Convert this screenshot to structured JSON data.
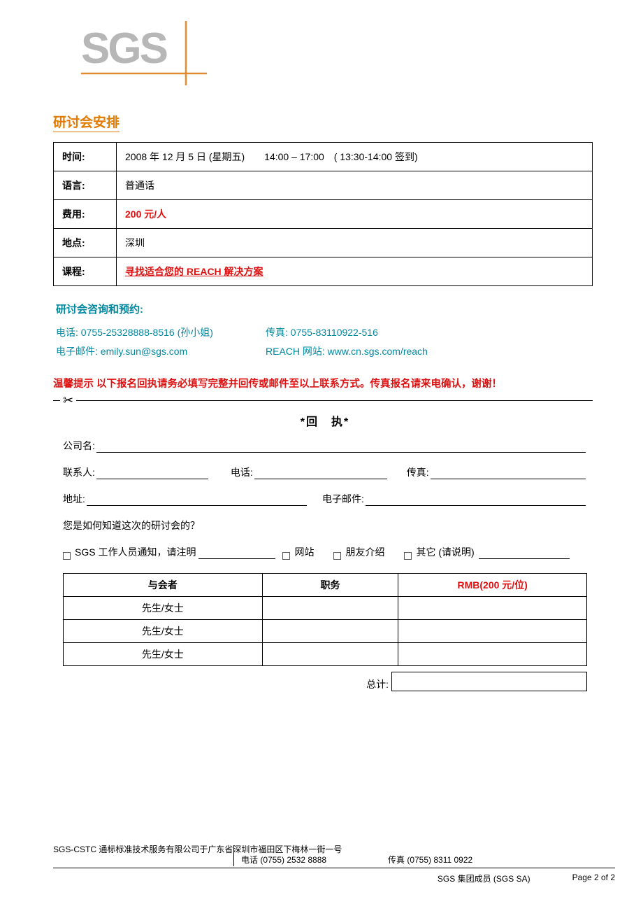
{
  "section_title": "研讨会安排",
  "info": {
    "time_label": "时间:",
    "time_value": "2008 年 12 月 5 日 (星期五)　　14:00 – 17:00　( 13:30-14:00 签到)",
    "lang_label": "语言:",
    "lang_value": "普通话",
    "fee_label": "费用:",
    "fee_value": "200 元/人",
    "loc_label": "地点:",
    "loc_value": "深圳",
    "course_label": "课程:",
    "course_value": "寻找适合您的 REACH 解决方案"
  },
  "contact": {
    "title": "研讨会咨询和预约:",
    "phone": "电话: 0755-25328888-8516 (孙小姐)",
    "fax": "传真: 0755-83110922-516",
    "email": "电子邮件: emily.sun@sgs.com",
    "site": "REACH 网站: www.cn.sgs.com/reach"
  },
  "warn": "温馨提示  以下报名回执请务必填写完整并回传或邮件至以上联系方式。传真报名请来电确认，谢谢！",
  "reply": {
    "title": "*回　执*",
    "company": "公司名:",
    "contact": "联系人:",
    "phone": "电话:",
    "fax": "传真:",
    "addr": "地址:",
    "email": "电子邮件:",
    "how": "您是如何知道这次的研讨会的？",
    "opt1": "SGS 工作人员通知，请注明",
    "opt2": "网站",
    "opt3": "朋友介绍",
    "opt4": "其它 (请说明)",
    "col1": "与会者",
    "col2": "职务",
    "col3": "RMB(200 元/位)",
    "salutation": "先生/女士",
    "total": "总计:"
  },
  "footer": {
    "company": "SGS-CSTC 通标标准技术服务有限公司于广东省深圳市福田区下梅林一街一号",
    "phone": "电话  (0755) 2532 8888",
    "fax": "传真  (0755) 8311 0922",
    "member": "SGS 集团成员  (SGS SA)",
    "page": "Page 2 of 2"
  }
}
